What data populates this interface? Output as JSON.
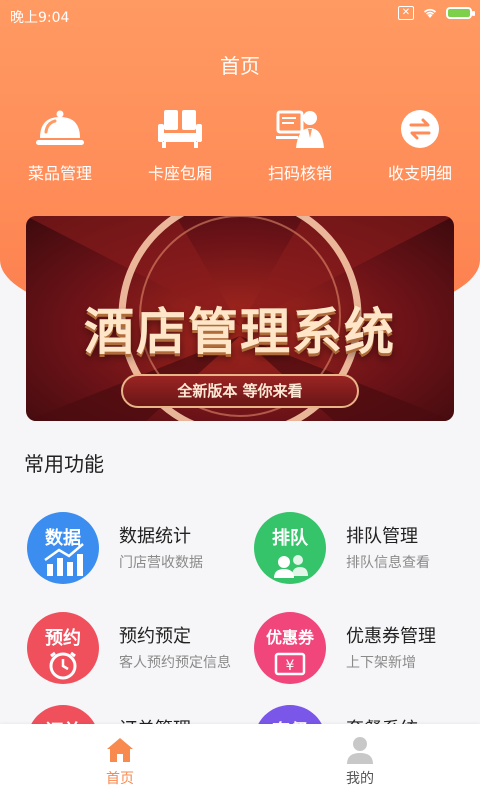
{
  "status_bar": {
    "time": "晚上9:04"
  },
  "header": {
    "title": "首页"
  },
  "quick_nav": [
    {
      "label": "菜品管理",
      "icon": "cloche-icon"
    },
    {
      "label": "卡座包厢",
      "icon": "sofa-icon"
    },
    {
      "label": "扫码核销",
      "icon": "scan-verify-icon"
    },
    {
      "label": "收支明细",
      "icon": "exchange-icon"
    }
  ],
  "banner": {
    "title": "酒店管理系统",
    "subtitle": "全新版本 等你来看"
  },
  "section": {
    "title": "常用功能"
  },
  "features": [
    {
      "badge": "数据",
      "name": "数据统计",
      "desc": "门店营收数据",
      "color": "#3b8df0",
      "icon": "chart-icon"
    },
    {
      "badge": "排队",
      "name": "排队管理",
      "desc": "排队信息查看",
      "color": "#35c46a",
      "icon": "users-icon"
    },
    {
      "badge": "预约",
      "name": "预约预定",
      "desc": "客人预约预定信息",
      "color": "#f0505c",
      "icon": "alarm-clock-icon"
    },
    {
      "badge": "优惠券",
      "name": "优惠券管理",
      "desc": "上下架新增",
      "color": "#f0467c",
      "icon": "coupon-icon"
    },
    {
      "badge": "订单",
      "name": "订单管理",
      "desc": "",
      "color": "#f0505c",
      "icon": "order-icon"
    },
    {
      "badge": "套餐",
      "name": "套餐系统",
      "desc": "",
      "color": "#7a57e8",
      "icon": "package-icon"
    }
  ],
  "tabbar": [
    {
      "label": "首页",
      "icon": "home-icon",
      "active": true,
      "color": "#f98a4f"
    },
    {
      "label": "我的",
      "icon": "user-icon",
      "active": false,
      "color": "#555555"
    }
  ]
}
